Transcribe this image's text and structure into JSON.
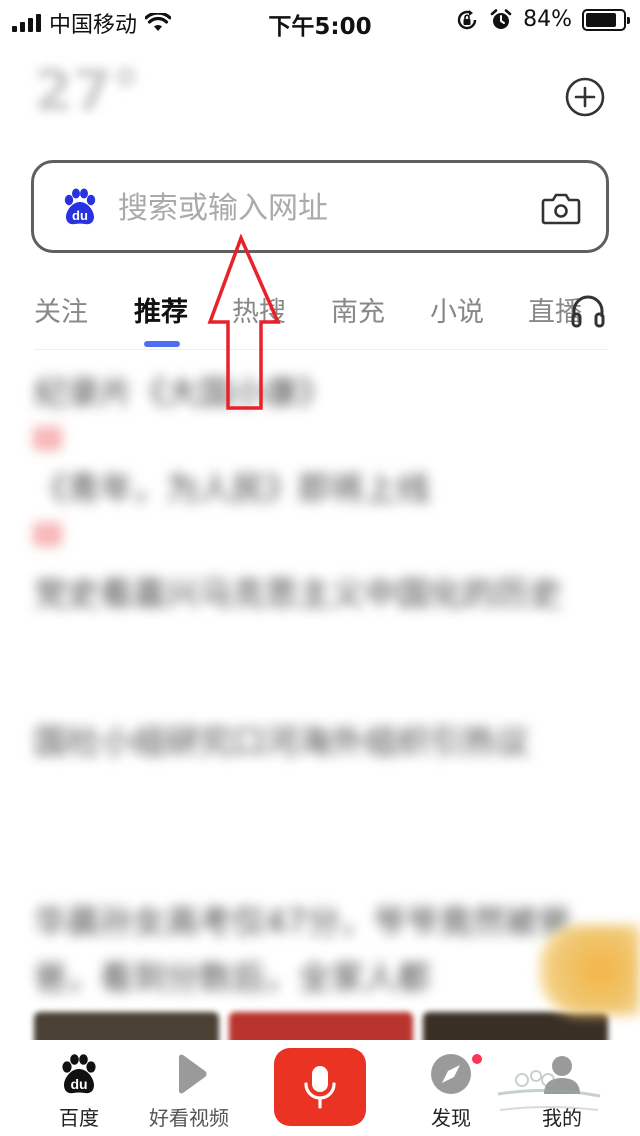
{
  "status_bar": {
    "carrier": "中国移动",
    "time": "下午5:00",
    "battery": "84%",
    "battery_fraction": 0.84
  },
  "weather": {
    "temperature": "27°",
    "info_line1": "",
    "info_line2": ""
  },
  "search": {
    "placeholder": "搜索或输入网址"
  },
  "tabs": [
    {
      "label": "关注"
    },
    {
      "label": "推荐"
    },
    {
      "label": "热搜"
    },
    {
      "label": "南充"
    },
    {
      "label": "小说"
    },
    {
      "label": "直播"
    }
  ],
  "feed": [
    {
      "title": "纪录片《大国小康》",
      "tag": "热",
      "meta": ""
    },
    {
      "title": "《青年，为人民》即将上线",
      "tag": "热",
      "meta": ""
    },
    {
      "title": "党史看嘉兴马克思主义中国化的历史",
      "tag": "",
      "meta": ""
    },
    {
      "title": "国社小组研究口河海外组织引热议",
      "tag": "",
      "meta": ""
    },
    {
      "title": "华晨孙女高考仅47分，爷爷竟然被爸爸，看到分数后，全家人都",
      "tag": "",
      "meta": ""
    }
  ],
  "bottom_nav": {
    "baidu": "百度",
    "video": "好看视频",
    "discover": "发现",
    "mine": "我的"
  },
  "colors": {
    "accent": "#4e6ef2",
    "voice_red": "#ea3323",
    "annotation_red": "#e8212a",
    "search_border": "#5f5f5f"
  },
  "icons": {
    "add": "plus-circle-icon",
    "camera": "camera-icon",
    "headphone": "headphone-icon",
    "baidu": "baidu-paw-icon",
    "video": "play-icon",
    "voice": "microphone-icon",
    "discover": "compass-icon",
    "mine": "user-icon"
  }
}
